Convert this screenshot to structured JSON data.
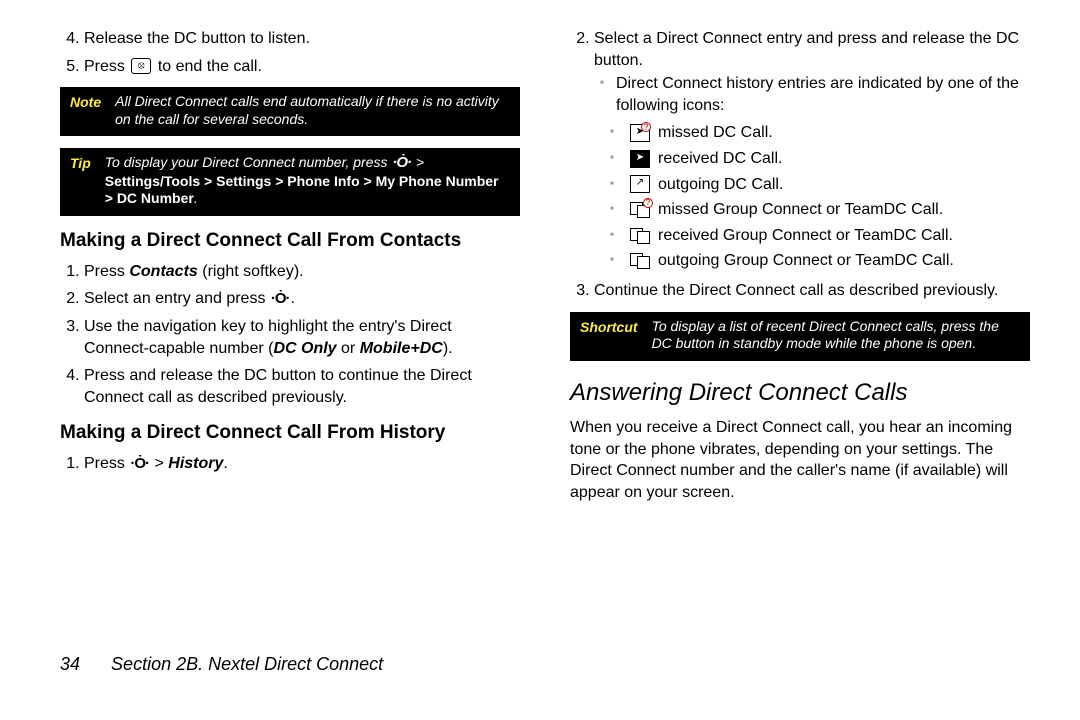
{
  "col1": {
    "step4": "Release the DC button to listen.",
    "step5a": "Press",
    "step5b": "to end the call.",
    "note_label": "Note",
    "note_text": "All Direct Connect calls end automatically if there is no activity on the call for several seconds.",
    "tip_label": "Tip",
    "tip_text_a": "To display your Direct Connect number, press",
    "tip_text_b": "Settings/Tools > Settings > Phone Info > My Phone Number > DC Number",
    "h_contacts": "Making a Direct Connect Call From Contacts",
    "c1a": "Press ",
    "c1b": "Contacts",
    "c1c": " (right softkey).",
    "c2": "Select an entry and press",
    "c3a": "Use the navigation key to highlight the entry's Direct Connect-capable number (",
    "c3b": "DC Only",
    "c3c": " or ",
    "c3d": "Mobile+DC",
    "c3e": ").",
    "c4": "Press and release the DC button to continue the Direct Connect call as described previously.",
    "h_history": "Making a Direct Connect Call From History",
    "h1a": "Press",
    "h1b": "History"
  },
  "col2": {
    "s2": "Select a Direct Connect entry and press and release the DC button.",
    "sublead": "Direct Connect history entries are indicated by one of the following icons:",
    "i1": "missed DC Call.",
    "i2": "received DC Call.",
    "i3": "outgoing DC Call.",
    "i4": "missed Group Connect or TeamDC Call.",
    "i5": "received Group Connect or TeamDC Call.",
    "i6": "outgoing Group Connect or TeamDC Call.",
    "s3": "Continue the Direct Connect call as described previously.",
    "sc_label": "Shortcut",
    "sc_text": "To display a list of recent Direct Connect calls, press the DC button in standby mode while the phone is open.",
    "h_answer": "Answering Direct Connect Calls",
    "answer_p": "When you receive a Direct Connect call, you hear an incoming tone or the phone vibrates, depending on your settings. The Direct Connect number and the caller's name (if available) will appear on your screen."
  },
  "footer": {
    "page": "34",
    "section": "Section 2B. Nextel Direct Connect"
  }
}
